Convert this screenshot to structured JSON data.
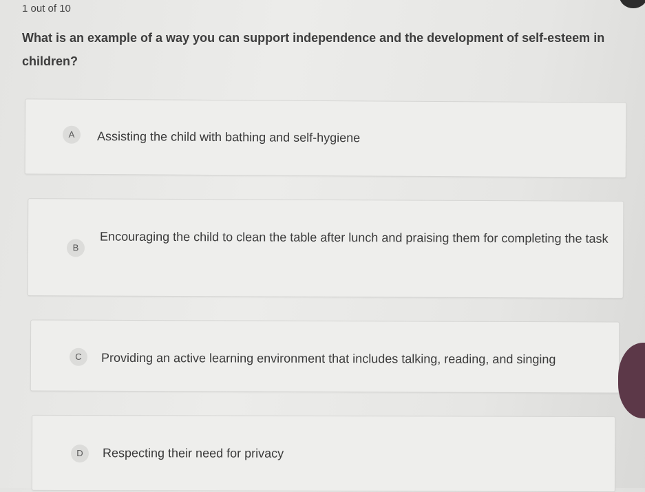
{
  "quiz": {
    "progress": "1 out of 10",
    "question": "What is an example of a way you can support independence and the development of self-esteem in children?",
    "options": [
      {
        "letter": "A",
        "text": "Assisting the child with bathing and self-hygiene"
      },
      {
        "letter": "B",
        "text": "Encouraging the child to clean the table after lunch and praising them for completing the task"
      },
      {
        "letter": "C",
        "text": "Providing an active learning environment that includes talking, reading, and singing"
      },
      {
        "letter": "D",
        "text": "Respecting their need for privacy"
      }
    ]
  }
}
